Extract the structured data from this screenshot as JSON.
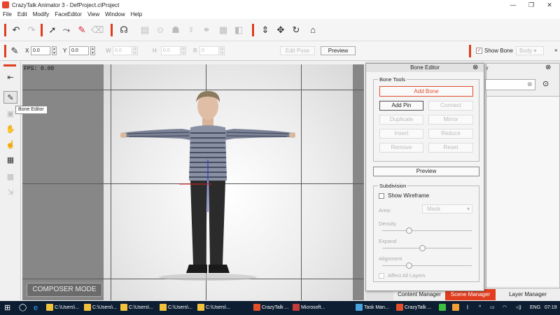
{
  "window": {
    "title": "CrazyTalk Animator 3  - DefProject.ctProject",
    "minimize": "—",
    "maximize": "❐",
    "close": "✕"
  },
  "menu": [
    "File",
    "Edit",
    "Modify",
    "FaceEditor",
    "View",
    "Window",
    "Help"
  ],
  "toolbar2": {
    "x_label": "X",
    "x_value": "0.0",
    "y_label": "Y",
    "y_value": "0.0",
    "w_label": "W",
    "w_value": "0.0",
    "h_label": "H",
    "h_value": "0.0",
    "r_label": "R",
    "r_value": "0",
    "edit_pose": "Edit Pose",
    "preview": "Preview",
    "show_bone": "Show Bone",
    "show_bone_checked": true,
    "body_select": "Body",
    "more": "»"
  },
  "tooltip": "Bone Editor",
  "viewport": {
    "fps": "FPS: 0.00",
    "composer_mode": "COMPOSER MODE"
  },
  "bone_editor": {
    "title": "Bone Editor",
    "bone_tools_label": "Bone Tools",
    "add_bone": "Add Bone",
    "add_pin": "Add Pin",
    "connect": "Connect",
    "duplicate": "Duplicate",
    "mirror": "Mirror",
    "insert": "Insert",
    "reduce": "Reduce",
    "remove": "Remove",
    "reset": "Reset",
    "preview": "Preview",
    "subdivision_label": "Subdivision",
    "show_wireframe": "Show Wireframe",
    "area_label": "Area:",
    "area_value": "Mask",
    "density_label": "Density",
    "density_value": 0.3,
    "expand_label": "Expand",
    "expand_value": 0.45,
    "alignment_label": "Alignment",
    "alignment_value": 0.3,
    "affect_all_layers": "Affect All Layers"
  },
  "right_panel": {
    "partial_title": "r"
  },
  "dock_tabs": {
    "content_manager": "Content Manager",
    "scene_manager": "Scene Manager",
    "layer_manager": "Layer Manager"
  },
  "taskbar": {
    "items": [
      {
        "label": "C:\\Users\\...",
        "color": "#f3c23c"
      },
      {
        "label": "C:\\Users\\...",
        "color": "#f3c23c"
      },
      {
        "label": "C:\\Users\\...",
        "color": "#f3c23c"
      },
      {
        "label": "C:\\Users\\...",
        "color": "#f3c23c"
      },
      {
        "label": "C:\\Users\\...",
        "color": "#f3c23c"
      },
      {
        "label": "CrazyTalk ...",
        "color": "#e34f2b"
      },
      {
        "label": "Microsoft...",
        "color": "#c33b3b"
      },
      {
        "label": "Task Man...",
        "color": "#4aa3e0"
      },
      {
        "label": "CrazyTalk ...",
        "color": "#e34f2b"
      }
    ],
    "language": "ENG",
    "time": "07:19"
  },
  "colors": {
    "accent": "#e03c1e",
    "add_bone_border": "#e0502a",
    "scene_manager_tab": "#e03c1e",
    "taskbar": "#0d1e33"
  }
}
